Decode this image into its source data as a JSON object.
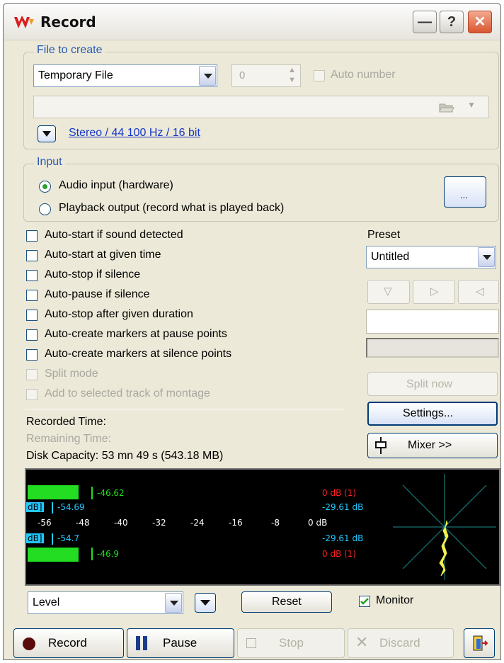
{
  "window": {
    "title": "Record"
  },
  "titlebar": {
    "minimize_label": "—",
    "help_label": "?",
    "close_label": "✕"
  },
  "file_group": {
    "legend": "File to create",
    "file_type": "Temporary File",
    "number_value": "0",
    "auto_number_label": "Auto number",
    "path_value": "",
    "format_link": "Stereo / 44 100 Hz / 16 bit"
  },
  "input_group": {
    "legend": "Input",
    "options": [
      "Audio input (hardware)",
      "Playback output (record what is played back)"
    ],
    "selected": 0,
    "dots_button": "..."
  },
  "options": [
    {
      "label": "Auto-start if sound detected",
      "enabled": true,
      "checked": false
    },
    {
      "label": "Auto-start at given time",
      "enabled": true,
      "checked": false
    },
    {
      "label": "Auto-stop if silence",
      "enabled": true,
      "checked": false
    },
    {
      "label": "Auto-pause if silence",
      "enabled": true,
      "checked": false
    },
    {
      "label": "Auto-stop after given duration",
      "enabled": true,
      "checked": false
    },
    {
      "label": "Auto-create markers at pause points",
      "enabled": true,
      "checked": false
    },
    {
      "label": "Auto-create markers at silence points",
      "enabled": true,
      "checked": false
    },
    {
      "label": "Split mode",
      "enabled": false,
      "checked": false
    },
    {
      "label": "Add to selected track of montage",
      "enabled": false,
      "checked": false
    }
  ],
  "preset": {
    "label": "Preset",
    "value": "Untitled",
    "name_field": "",
    "split_now": "Split now",
    "settings": "Settings...",
    "mixer": "Mixer >>"
  },
  "status": {
    "recorded_time": "Recorded Time:",
    "remaining_time": "Remaining Time:",
    "disk_capacity": "Disk Capacity: 53 mn 49 s (543.18 MB)"
  },
  "meter": {
    "top_peak_l": "-46.62",
    "top_clip_l": "0 dB (1)",
    "rms_l_tag": "dB]",
    "rms_l": "-54.69",
    "rms_l_right": "-29.61 dB",
    "scale": [
      "-56",
      "-48",
      "-40",
      "-32",
      "-24",
      "-16",
      "-8",
      "0 dB"
    ],
    "rms_r_tag": "dB]",
    "rms_r": "-54.7",
    "rms_r_right": "-29.61 dB",
    "bottom_peak_r": "-46.9",
    "bottom_clip_r": "0 dB (1)",
    "colors": {
      "peak": "#22dd22",
      "rms": "#22c8ff",
      "clip": "#ff2020",
      "phase": "#f4f24a"
    }
  },
  "controls": {
    "meter_mode": "Level",
    "reset": "Reset",
    "monitor_label": "Monitor",
    "monitor_checked": true
  },
  "transport": {
    "record": "Record",
    "pause": "Pause",
    "stop": "Stop",
    "discard": "Discard"
  }
}
